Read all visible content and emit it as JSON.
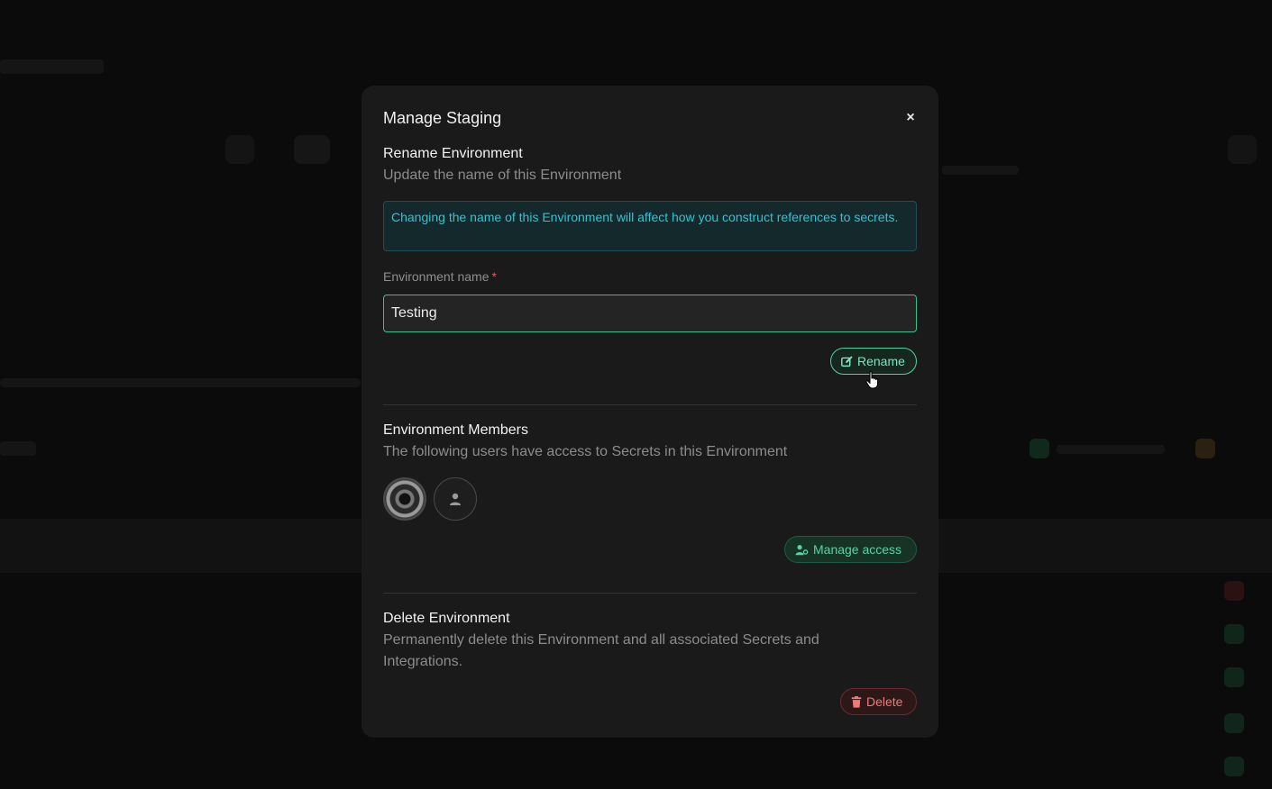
{
  "modal": {
    "title": "Manage Staging",
    "close_label": "×"
  },
  "rename": {
    "title": "Rename Environment",
    "description": "Update the name of this Environment",
    "alert": "Changing the name of this Environment will affect how you construct references to secrets.",
    "field_label": "Environment name",
    "required_mark": "*",
    "input_value": "Testing",
    "button_label": "Rename",
    "button_icon": "edit-icon"
  },
  "members": {
    "title": "Environment Members",
    "description": "The following users have access to Secrets in this Environment",
    "avatars": [
      "user-photo-avatar",
      "user-generic-avatar"
    ],
    "button_label": "Manage access",
    "button_icon": "user-gear-icon"
  },
  "delete": {
    "title": "Delete Environment",
    "description": "Permanently delete this Environment and all associated Secrets and Integrations.",
    "button_label": "Delete",
    "button_icon": "trash-icon"
  },
  "colors": {
    "accent_green": "#35c28a",
    "info_cyan": "#2fc4d6",
    "danger_red": "#f07a7a",
    "modal_bg": "#1a1a1a"
  }
}
